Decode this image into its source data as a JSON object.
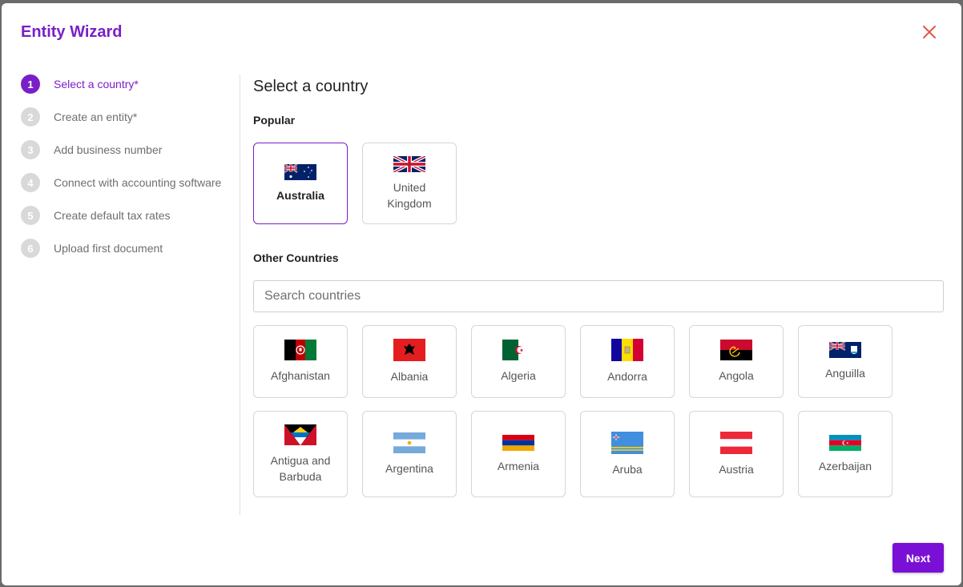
{
  "modal": {
    "title": "Entity Wizard"
  },
  "steps": [
    {
      "num": "1",
      "label": "Select a country*",
      "active": true
    },
    {
      "num": "2",
      "label": "Create an entity*",
      "active": false
    },
    {
      "num": "3",
      "label": "Add business number",
      "active": false
    },
    {
      "num": "4",
      "label": "Connect with accounting software",
      "active": false
    },
    {
      "num": "5",
      "label": "Create default tax rates",
      "active": false
    },
    {
      "num": "6",
      "label": "Upload first document",
      "active": false
    }
  ],
  "main": {
    "title": "Select a country",
    "popular_label": "Popular",
    "other_label": "Other Countries",
    "search_placeholder": "Search countries"
  },
  "popular": [
    {
      "name": "Australia",
      "flag": "australia-flag-icon",
      "selected": true
    },
    {
      "name": "United Kingdom",
      "flag": "uk-flag-icon",
      "selected": false
    }
  ],
  "countries": [
    {
      "name": "Afghanistan",
      "flag": "afghanistan-flag-icon"
    },
    {
      "name": "Albania",
      "flag": "albania-flag-icon"
    },
    {
      "name": "Algeria",
      "flag": "algeria-flag-icon"
    },
    {
      "name": "Andorra",
      "flag": "andorra-flag-icon"
    },
    {
      "name": "Angola",
      "flag": "angola-flag-icon"
    },
    {
      "name": "Anguilla",
      "flag": "anguilla-flag-icon"
    },
    {
      "name": "Antigua and Barbuda",
      "flag": "antigua-flag-icon"
    },
    {
      "name": "Argentina",
      "flag": "argentina-flag-icon"
    },
    {
      "name": "Armenia",
      "flag": "armenia-flag-icon"
    },
    {
      "name": "Aruba",
      "flag": "aruba-flag-icon"
    },
    {
      "name": "Austria",
      "flag": "austria-flag-icon"
    },
    {
      "name": "Azerbaijan",
      "flag": "azerbaijan-flag-icon"
    }
  ],
  "footer": {
    "next_label": "Next"
  },
  "colors": {
    "accent": "#7a1fc7",
    "button": "#7a10d6",
    "inactive_step": "#d9d9d9"
  }
}
